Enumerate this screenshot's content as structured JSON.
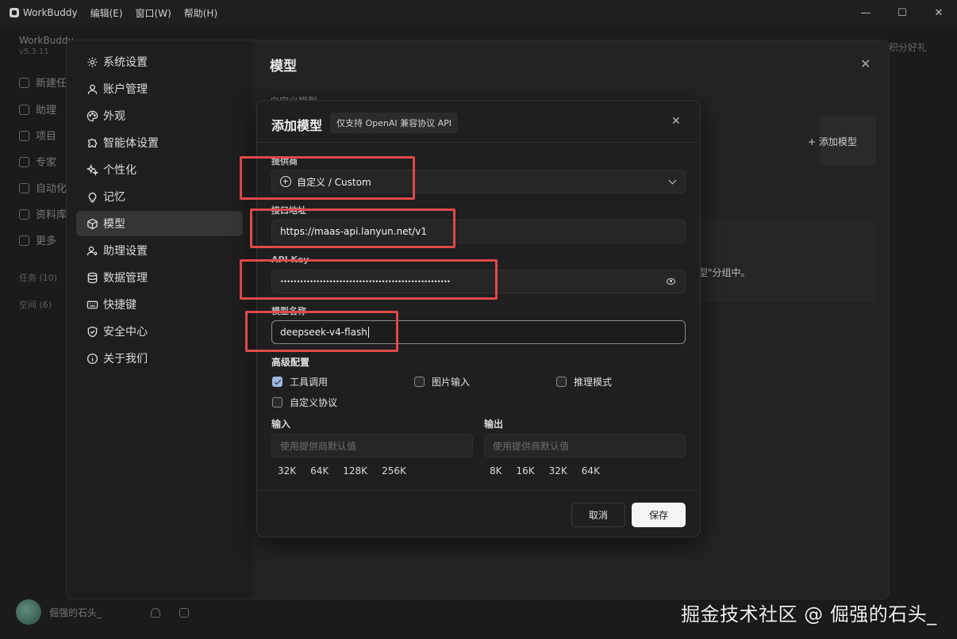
{
  "titlebar": {
    "app_name": "WorkBuddy",
    "menus": [
      "编辑(E)",
      "窗口(W)",
      "帮助(H)"
    ],
    "controls": {
      "minimize": "—",
      "maximize": "☐",
      "close": "✕"
    }
  },
  "background": {
    "app_name": "WorkBuddy",
    "version": "v5.3.11",
    "nav": [
      "新建任务",
      "助理",
      "项目",
      "专家",
      "自动化",
      "资料库",
      "更多"
    ],
    "groups": [
      "任务 (10)",
      "空间 (6)"
    ],
    "user_name": "倔强的石头_",
    "points_text": "积分好礼",
    "watermark": "掘金技术社区 @ 倔强的石头_"
  },
  "settings": {
    "nav": [
      {
        "label": "系统设置",
        "icon": "gear-icon"
      },
      {
        "label": "账户管理",
        "icon": "user-icon"
      },
      {
        "label": "外观",
        "icon": "palette-icon"
      },
      {
        "label": "智能体设置",
        "icon": "puzzle-icon"
      },
      {
        "label": "个性化",
        "icon": "sparkle-icon"
      },
      {
        "label": "记忆",
        "icon": "bulb-icon"
      },
      {
        "label": "模型",
        "icon": "cube-icon",
        "active": true
      },
      {
        "label": "助理设置",
        "icon": "assistant-icon"
      },
      {
        "label": "数据管理",
        "icon": "database-icon"
      },
      {
        "label": "快捷键",
        "icon": "keyboard-icon"
      },
      {
        "label": "安全中心",
        "icon": "shield-icon"
      },
      {
        "label": "关于我们",
        "icon": "info-icon"
      }
    ],
    "title": "模型",
    "close": "✕",
    "section_label": "自定义模型",
    "add_model": "+ 添加模型",
    "group_hint": "型\"分组中。"
  },
  "dialog": {
    "title": "添加模型",
    "badge": "仅支持 OpenAI 兼容协议 API",
    "close": "✕",
    "provider": {
      "label": "提供商",
      "value": "自定义 / Custom"
    },
    "endpoint": {
      "label": "接口地址",
      "value": "https://maas-api.lanyun.net/v1"
    },
    "api_key": {
      "label": "API Key",
      "value": "••••••••••••••••••••••••••••••••••••••••••••••••••••"
    },
    "model_name": {
      "label": "模型名称",
      "value": "deepseek-v4-flash"
    },
    "advanced": {
      "label": "高级配置",
      "options": [
        {
          "label": "工具调用",
          "checked": true
        },
        {
          "label": "图片输入",
          "checked": false
        },
        {
          "label": "推理模式",
          "checked": false
        },
        {
          "label": "自定义协议",
          "checked": false
        }
      ]
    },
    "input": {
      "label": "输入",
      "placeholder": "使用提供商默认值",
      "chips": [
        "32K",
        "64K",
        "128K",
        "256K"
      ]
    },
    "output": {
      "label": "输出",
      "placeholder": "使用提供商默认值",
      "chips": [
        "8K",
        "16K",
        "32K",
        "64K"
      ]
    },
    "buttons": {
      "cancel": "取消",
      "save": "保存"
    }
  },
  "colors": {
    "annotation_red": "#e0484a",
    "checkbox_accent": "#9db7e0"
  }
}
